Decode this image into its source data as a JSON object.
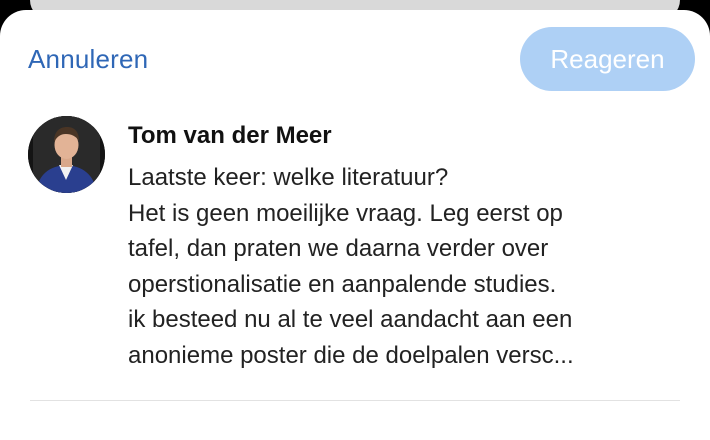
{
  "header": {
    "cancel_label": "Annuleren",
    "reply_label": "Reageren"
  },
  "post": {
    "author": "Tom van der Meer",
    "lines": [
      "Laatste keer: welke literatuur?",
      "Het is geen moeilijke vraag. Leg eerst op",
      "tafel, dan praten we daarna verder over",
      "operstionalisatie en aanpalende studies.",
      "ik besteed nu al te veel aandacht aan een",
      "anonieme poster die de doelpalen versc..."
    ]
  },
  "colors": {
    "link": "#2f67b6",
    "reply_button_bg": "#aed0f5"
  }
}
